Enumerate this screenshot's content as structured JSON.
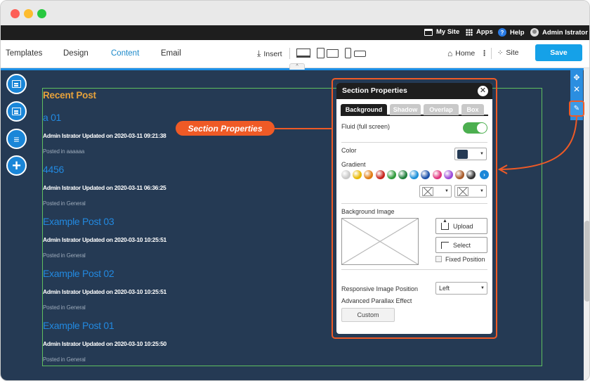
{
  "topbar": {
    "my_site": "My Site",
    "apps": "Apps",
    "help": "Help",
    "user": "Admin Istrator"
  },
  "menu": {
    "tabs": [
      "Templates",
      "Design",
      "Content",
      "Email"
    ],
    "active_tab": "Content",
    "insert": "Insert",
    "home": "Home",
    "site": "Site",
    "save": "Save"
  },
  "content": {
    "heading": "Recent Post",
    "posts": [
      {
        "title": "a 01",
        "meta": "Admin Istrator Updated on 2020-03-11 09:21:38",
        "category": "Posted in aaaaaa"
      },
      {
        "title": "4456",
        "meta": "Admin Istrator Updated on 2020-03-11 06:36:25",
        "category": "Posted in General"
      },
      {
        "title": "Example Post 03",
        "meta": "Admin Istrator Updated on 2020-03-10 10:25:51",
        "category": "Posted in General"
      },
      {
        "title": "Example Post 02",
        "meta": "Admin Istrator Updated on 2020-03-10 10:25:51",
        "category": "Posted in General"
      },
      {
        "title": "Example Post 01",
        "meta": "Admin Istrator Updated on 2020-03-10 10:25:50",
        "category": "Posted in General"
      }
    ]
  },
  "callout": {
    "label": "Section Properties"
  },
  "dialog": {
    "title": "Section Properties",
    "close": "✕",
    "tabs": [
      "Background",
      "Shadow",
      "Overlap",
      "Box"
    ],
    "active_tab": "Background",
    "fluid_label": "Fluid (full screen)",
    "fluid_on": true,
    "color_label": "Color",
    "color_value": "#253a54",
    "gradient_label": "Gradient",
    "gradient_colors": [
      "#c8c8c8",
      "#e8b800",
      "#e07a10",
      "#c8241c",
      "#2e9a3a",
      "#1e7e3a",
      "#1a8fd8",
      "#1a4fa8",
      "#e0307a",
      "#9a48d8",
      "#a85a28",
      "#333333"
    ],
    "bg_image_label": "Background Image",
    "upload": "Upload",
    "select": "Select",
    "fixed_position": "Fixed Position",
    "fixed_position_checked": false,
    "responsive_label": "Responsive Image Position",
    "responsive_value": "Left",
    "parallax_label": "Advanced Parallax Effect",
    "custom": "Custom"
  },
  "colors": {
    "accent": "#15a1e8",
    "canvas": "#253a54",
    "callout": "#ef5a26",
    "post_title": "#2289e0",
    "heading": "#e7a23b"
  }
}
